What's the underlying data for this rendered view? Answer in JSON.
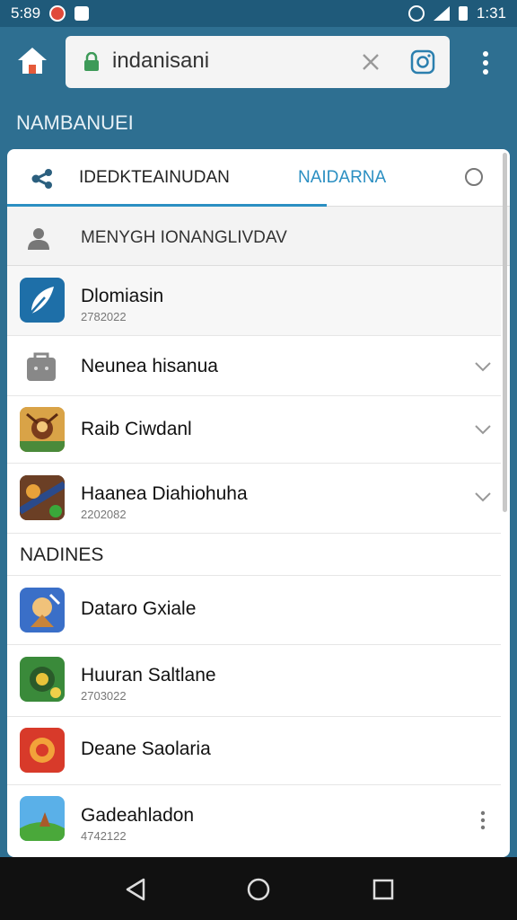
{
  "status_bar": {
    "time": "5:89",
    "right_text": "1:31"
  },
  "browser": {
    "url": "indanisani",
    "icons": {
      "home": "home-icon",
      "lock": "lock-icon",
      "clear": "close-icon",
      "ig": "instagram-icon",
      "menu": "more-vert-icon"
    }
  },
  "top_section_title": "NAMBANUEI",
  "tabs": [
    {
      "label": "IDEDKTEAINUDAN",
      "active": true
    },
    {
      "label": "NAIDARNA",
      "active": false
    }
  ],
  "account_row": {
    "label": "MENYGH IONANGLIVDAV"
  },
  "top_items": [
    {
      "title": "Dlomiasin",
      "subtitle": "2782022",
      "icon": "feather-icon"
    },
    {
      "title": "Neunea hisanua",
      "subtitle": "",
      "icon": "bag-icon"
    },
    {
      "title": "Raib Ciwdanl",
      "subtitle": "",
      "icon": "game-icon"
    },
    {
      "title": "Haanea Diahiohuha",
      "subtitle": "2202082",
      "icon": "game-icon"
    }
  ],
  "mid_section_title": "NADINES",
  "bottom_items": [
    {
      "title": "Dataro Gxiale",
      "subtitle": "",
      "icon": "game-icon"
    },
    {
      "title": "Huuran Saltlane",
      "subtitle": "2703022",
      "icon": "game-icon"
    },
    {
      "title": "Deane Saolaria",
      "subtitle": "",
      "icon": "game-icon"
    },
    {
      "title": "Gadeahladon",
      "subtitle": "4742122",
      "icon": "game-icon"
    }
  ],
  "colors": {
    "header": "#2e6f91",
    "accent": "#2b8fc2"
  }
}
